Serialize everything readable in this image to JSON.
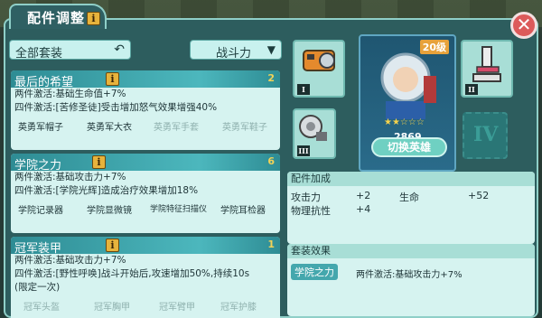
{
  "header": {
    "title": "配件调整",
    "info_icon": "i"
  },
  "filter": {
    "label": "全部套装"
  },
  "sort": {
    "label": "战斗力"
  },
  "sets": [
    {
      "name": "最后的希望",
      "count": "2",
      "effects": [
        "两件激活:基础生命值+7%",
        "四件激活:[苦修圣徒]受击增加怒气效果增强40%"
      ],
      "pieces": [
        "英勇军帽子",
        "英勇军大衣",
        "英勇军手套",
        "英勇军鞋子"
      ]
    },
    {
      "name": "学院之力",
      "count": "6",
      "effects": [
        "两件激活:基础攻击力+7%",
        "四件激活:[学院光辉]造成治疗效果增加18%"
      ],
      "pieces": [
        "学院记录器",
        "学院显微镜",
        "学院特征扫描仪",
        "学院耳检器"
      ]
    },
    {
      "name": "冠军装甲",
      "count": "1",
      "effects": [
        "两件激活:基础攻击力+7%",
        "四件激活:[野性呼唤]战斗开始后,攻速增加50%,持续10s",
        "(限定一次)"
      ],
      "pieces": [
        "冠军头盔",
        "冠军胸甲",
        "冠军臂甲",
        "冠军护膝"
      ]
    }
  ],
  "slots": [
    "I",
    "II",
    "III",
    "IV"
  ],
  "hero": {
    "level": "20级",
    "power": "2869",
    "switch_label": "切换英雄"
  },
  "bonus": {
    "title": "配件加成",
    "rows": [
      {
        "label": "攻击力",
        "value": "+2"
      },
      {
        "label": "生命",
        "value": "+52"
      },
      {
        "label": "物理抗性",
        "value": "+4"
      }
    ]
  },
  "set_effect": {
    "title": "套装效果",
    "chip": "学院之力",
    "text": "两件激活:基础攻击力+7%"
  },
  "colors": {
    "panel": "#2d5d5e",
    "header": "#2e8c94",
    "count": "#f1d257",
    "close": "#dc5a5a"
  }
}
